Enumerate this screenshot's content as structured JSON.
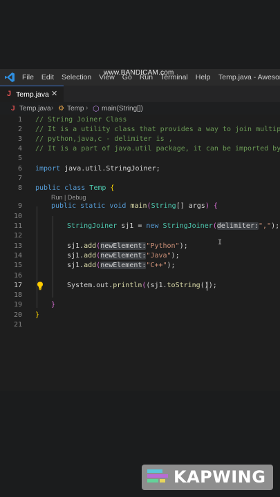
{
  "watermark": "www.BANDICAM.com",
  "menu": [
    "File",
    "Edit",
    "Selection",
    "View",
    "Go",
    "Run",
    "Terminal",
    "Help"
  ],
  "window_title": "Temp.java - Awesome",
  "tab": {
    "icon": "J",
    "label": "Temp.java",
    "close": "✕"
  },
  "breadcrumb": {
    "file": "Temp.java",
    "class": "Temp",
    "method": "main(String[])"
  },
  "line_numbers": [
    "1",
    "2",
    "3",
    "4",
    "5",
    "6",
    "7",
    "8",
    "",
    "9",
    "10",
    "11",
    "12",
    "13",
    "14",
    "15",
    "16",
    "17",
    "18",
    "19",
    "20",
    "21"
  ],
  "code_lens": "Run | Debug",
  "code": {
    "l1": "// String Joiner Class",
    "l2": "// It is a utility class that provides a way to join multiple",
    "l3": "// python,java,c - delimiter is ,",
    "l4": "// It is a part of java.util package, it can be imported by i",
    "l6_kw": "import",
    "l6_rest": " java.util.StringJoiner;",
    "l8_kw1": "public",
    "l8_kw2": "class",
    "l8_name": "Temp",
    "l8_brace": "{",
    "l9_kw1": "public",
    "l9_kw2": "static",
    "l9_kw3": "void",
    "l9_fn": "main",
    "l9_p1": "(",
    "l9_type": "String",
    "l9_arr": "[] args",
    "l9_p2": ")",
    "l9_brace": "{",
    "l11_type": "StringJoiner",
    "l11_var": " sj1 = ",
    "l11_new": "new",
    "l11_type2": "StringJoiner",
    "l11_p1": "(",
    "l11_hint": "delimiter:",
    "l11_str": "\",\"",
    "l11_end": ");",
    "add_prefix": "sj1.",
    "add_fn": "add",
    "add_hint": "newElement:",
    "l13_str": "\"Python\"",
    "l14_str": "\"Java\"",
    "l15_str": "\"C++\"",
    "add_end": ");",
    "l17_a": "System.out.",
    "l17_fn": "println",
    "l17_b": "(sj1.",
    "l17_fn2": "toString",
    "l17_c": "());",
    "l19_brace": "}",
    "l20_brace": "}"
  },
  "kapwing": "KAPWING"
}
